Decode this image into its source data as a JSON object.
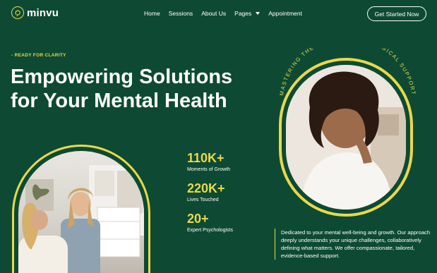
{
  "brand": {
    "name": "minvu",
    "accent": "#e8d94a",
    "background": "#0e4a33"
  },
  "nav": {
    "items": [
      {
        "label": "Home"
      },
      {
        "label": "Sessions"
      },
      {
        "label": "About Us"
      },
      {
        "label": "Pages",
        "icon": "caret-down-icon"
      },
      {
        "label": "Appointment"
      }
    ],
    "cta_label": "Get Started Now"
  },
  "hero": {
    "eyebrow": "- READY FOR CLARITY",
    "headline_line1": "Empowering Solutions",
    "headline_line2": "for Your Mental Health"
  },
  "stats": [
    {
      "value": "110K+",
      "label": "Moments of Growth"
    },
    {
      "value": "220K+",
      "label": "Lives Touched"
    },
    {
      "value": "20+",
      "label": "Expert Psychologists"
    }
  ],
  "curved_text": "MASTERING THE ART OF PSYCHOLOGICAL SUPPORT",
  "description": "Dedicated to your mental well-being and growth. Our approach deeply understands your unique challenges, collaboratively defining what matters. We offer compassionate, tailored, evidence-based support."
}
